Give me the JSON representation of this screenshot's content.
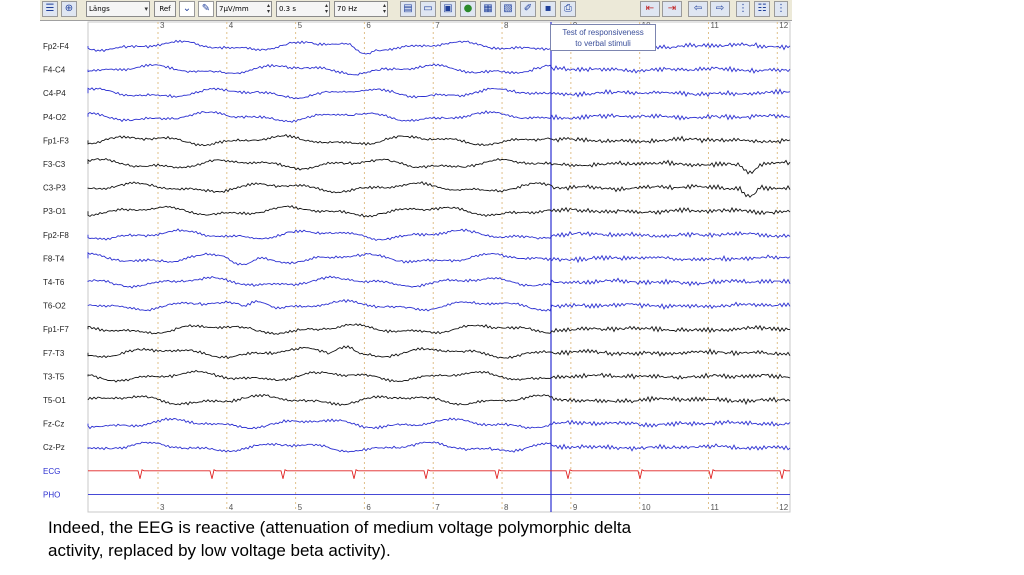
{
  "toolbar": {
    "montage_value": "Längs",
    "ref_label": "Ref",
    "sensitivity_value": "7µV/mm",
    "timeconstant_value": "0.3 s",
    "highfilter_value": "70 Hz",
    "icons": [
      "list-icon",
      "globe-icon",
      "filter-icon",
      "probe-icon",
      "display-layout-icon",
      "split-view-icon",
      "video-icon",
      "color-palette-icon",
      "montage-icon",
      "report-icon",
      "edit-icon",
      "save-icon",
      "print-icon",
      "page-back-icon",
      "page-forward-icon",
      "page-start-icon",
      "page-end-icon",
      "column-adjust-icon",
      "channel-adjust-icon"
    ]
  },
  "time_marks": [
    "3",
    "4",
    "5",
    "6",
    "7",
    "8",
    "9",
    "10",
    "11",
    "12"
  ],
  "channels": [
    {
      "label": "Fp2-F4",
      "color": "#2b2fd1"
    },
    {
      "label": "F4-C4",
      "color": "#2b2fd1"
    },
    {
      "label": "C4-P4",
      "color": "#2b2fd1"
    },
    {
      "label": "P4-O2",
      "color": "#2b2fd1"
    },
    {
      "label": "Fp1-F3",
      "color": "#111111"
    },
    {
      "label": "F3-C3",
      "color": "#111111"
    },
    {
      "label": "C3-P3",
      "color": "#111111"
    },
    {
      "label": "P3-O1",
      "color": "#111111"
    },
    {
      "label": "Fp2-F8",
      "color": "#2b2fd1"
    },
    {
      "label": "F8-T4",
      "color": "#2b2fd1"
    },
    {
      "label": "T4-T6",
      "color": "#2b2fd1"
    },
    {
      "label": "T6-O2",
      "color": "#2b2fd1"
    },
    {
      "label": "Fp1-F7",
      "color": "#111111"
    },
    {
      "label": "F7-T3",
      "color": "#111111"
    },
    {
      "label": "T3-T5",
      "color": "#111111"
    },
    {
      "label": "T5-O1",
      "color": "#111111"
    },
    {
      "label": "Fz-Cz",
      "color": "#2b2fd1"
    },
    {
      "label": "Cz-Pz",
      "color": "#2b2fd1"
    },
    {
      "label": "ECG",
      "color": "#e02020"
    },
    {
      "label": "PHO",
      "color": "#2b2fd1"
    }
  ],
  "annotation": {
    "line1": "Test of responsiveness",
    "line2": "to verbal stimuli"
  },
  "caption": {
    "line1": "Indeed, the EEG is reactive (attenuation of medium voltage polymorphic delta",
    "line2": "activity, replaced by low voltage beta activity)."
  },
  "colors": {
    "eeg_blue": "#2b2fd1",
    "eeg_black": "#111111",
    "ecg_red": "#e02020",
    "marker": "#2b2fd1",
    "grid": "#e0c08a"
  }
}
